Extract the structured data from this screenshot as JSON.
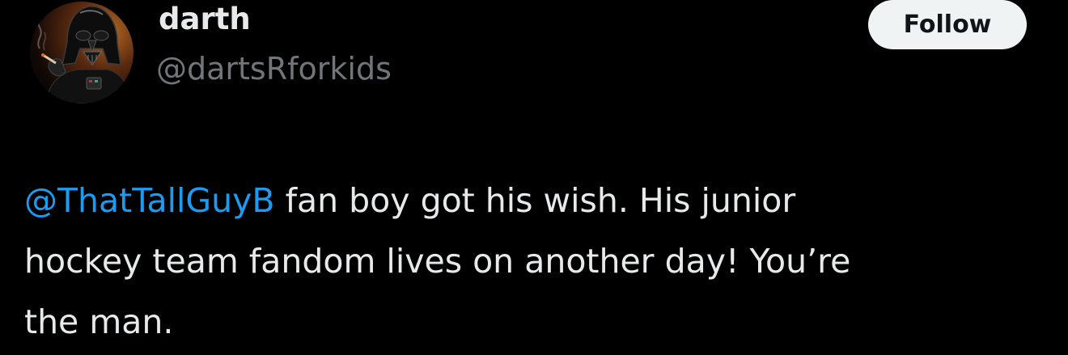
{
  "user": {
    "display_name": "darth",
    "handle": "@dartsRforkids",
    "avatar_icon": "darth-vader-avatar"
  },
  "follow_button": {
    "label": "Follow"
  },
  "tweet": {
    "mention": "@ThatTallGuyB",
    "line1_rest": " fan boy got his wish. His junior",
    "line2": "hockey team fandom lives on another day! You’re",
    "line3": "the man."
  },
  "colors": {
    "background": "#000000",
    "text": "#e7e9ea",
    "secondary_text": "#71767b",
    "mention": "#1d9bf0",
    "button_bg": "#eff3f4"
  }
}
